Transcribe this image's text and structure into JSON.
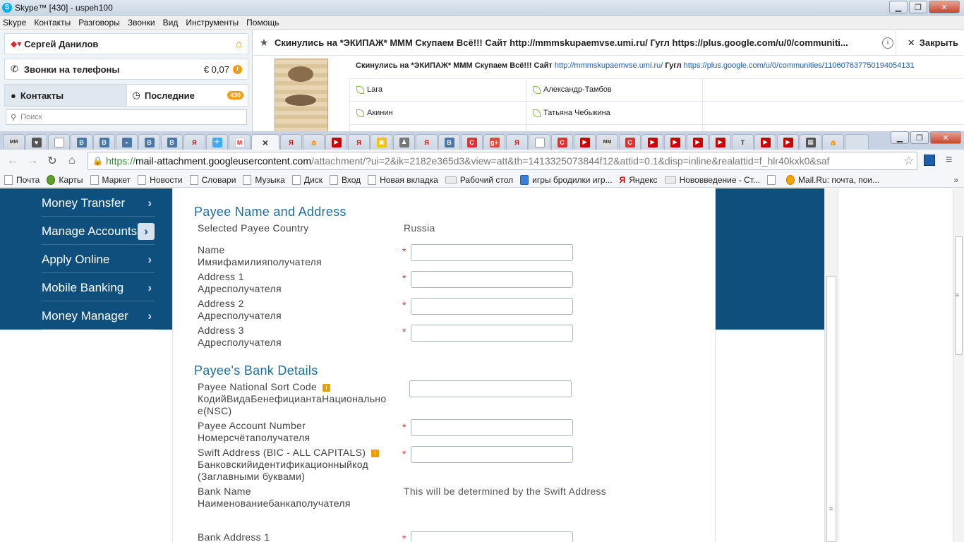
{
  "skype": {
    "window_title": "Skype™ [430] - uspeh100",
    "menu": [
      "Skype",
      "Контакты",
      "Разговоры",
      "Звонки",
      "Вид",
      "Инструменты",
      "Помощь"
    ],
    "user_name": "Сергей Данилов",
    "calls_label": "Звонки на телефоны",
    "credit": "€ 0,07",
    "credit_badge": "!",
    "tab_contacts": "Контакты",
    "tab_recent": "Последние",
    "recent_count": "430",
    "search_placeholder": "Поиск",
    "chat_title": "Скинулись на *ЭКИПАЖ* МММ Скупаем Всё!!! Сайт http://mmmskupaemvse.umi.ru/ Гугл https://plus.google.com/u/0/communiti...",
    "close_label": "Закрыть",
    "topic_bold": "Скинулись на *ЭКИПАЖ* МММ Скупаем Всё!!! Сайт",
    "topic_link1": "http://mmmskupaemvse.umi.ru/",
    "topic_mid": "Гугл",
    "topic_link2": "https://plus.google.com/u/0/communities/110607637750194054131",
    "contacts": [
      "Lara",
      "Александр-Тамбов",
      "Акинин",
      "Татьяна Чебыкина"
    ]
  },
  "browser": {
    "active_tab_icon": "×",
    "url_https": "https://",
    "url_host": "mail-attachment.googleusercontent.com",
    "url_rest": "/attachment/?ui=2&ik=2182e365d3&view=att&th=1413325073844f12&attid=0.1&disp=inline&realattid=f_hlr40kxk0&saf",
    "bookmarks": [
      "Почта",
      "Карты",
      "Маркет",
      "Новости",
      "Словари",
      "Музыка",
      "Диск",
      "Вход",
      "Новая вкладка",
      "Рабочий стол",
      "игры бродилки игр...",
      "Яндекс",
      "Нововведение - Ст...",
      "",
      "Mail.Ru: почта, пои..."
    ],
    "bookmarks_more": "»"
  },
  "page": {
    "nav": [
      "Money Transfer",
      "Manage Accounts",
      "Apply Online",
      "Mobile Banking",
      "Money Manager"
    ],
    "payee_section_title": "Payee Name and Address",
    "selected_country_label": "Selected Payee Country",
    "selected_country_value": "Russia",
    "name_label": "Name",
    "name_sub": "Имяифамилияполучателя",
    "addr1_label": "Address 1",
    "addr1_sub": "Адресполучателя",
    "addr2_label": "Address 2",
    "addr2_sub": "Адресполучателя",
    "addr3_label": "Address 3",
    "addr3_sub": "Адресполучателя",
    "bank_section_title": "Payee's Bank Details",
    "nsc_label": "Payee National Sort Code",
    "nsc_sub1": "КодийВидаБенефициантаНационально",
    "nsc_sub2": "е(NSC)",
    "account_label": "Payee Account Number",
    "account_sub": "Номерсчётаполучателя",
    "swift_label": "Swift Address (BIC - ALL CAPITALS)",
    "swift_sub1": "Банковскийидентификационныйкод",
    "swift_sub2": "(Заглавными буквами)",
    "bank_name_label": "Bank Name",
    "bank_name_sub": "Наименованиебанкаполучателя",
    "bank_name_value": "This will be determined by the Swift Address",
    "bank_addr1_label": "Bank Address 1",
    "required_mark": "*",
    "tip_mark": "i"
  }
}
